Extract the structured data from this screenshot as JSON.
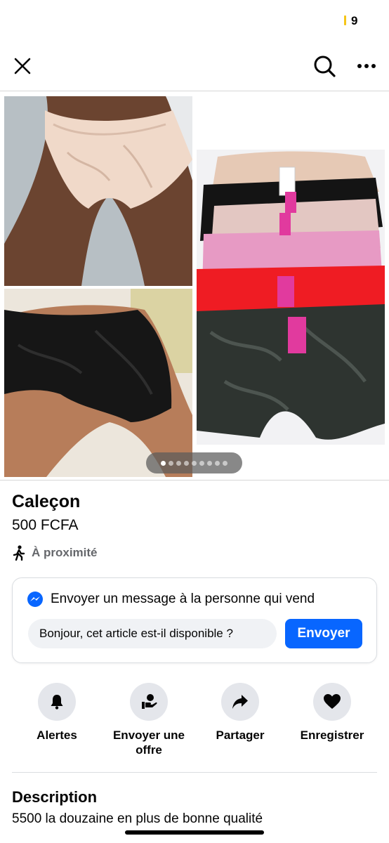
{
  "status_bar": {
    "battery_level": "9"
  },
  "nav": {
    "close_icon": "close-icon",
    "search_icon": "search-icon",
    "more_icon": "more-horizontal-icon"
  },
  "gallery": {
    "image_count": 9,
    "active_index": 0
  },
  "listing": {
    "title": "Caleçon",
    "price": "500 FCFA",
    "proximity": "À proximité"
  },
  "message": {
    "heading": "Envoyer un message à la personne qui vend",
    "input_value": "Bonjour, cet article est-il disponible ?",
    "send_label": "Envoyer"
  },
  "actions": [
    {
      "label": "Alertes",
      "icon": "bell-icon"
    },
    {
      "label": "Envoyer une offre",
      "icon": "offer-icon"
    },
    {
      "label": "Partager",
      "icon": "share-icon"
    },
    {
      "label": "Enregistrer",
      "icon": "heart-icon"
    }
  ],
  "description": {
    "heading": "Description",
    "text": "5500 la douzaine en plus de bonne qualité"
  },
  "colors": {
    "accent": "#0866ff",
    "muted": "#65676b",
    "chip": "#e4e6eb"
  }
}
